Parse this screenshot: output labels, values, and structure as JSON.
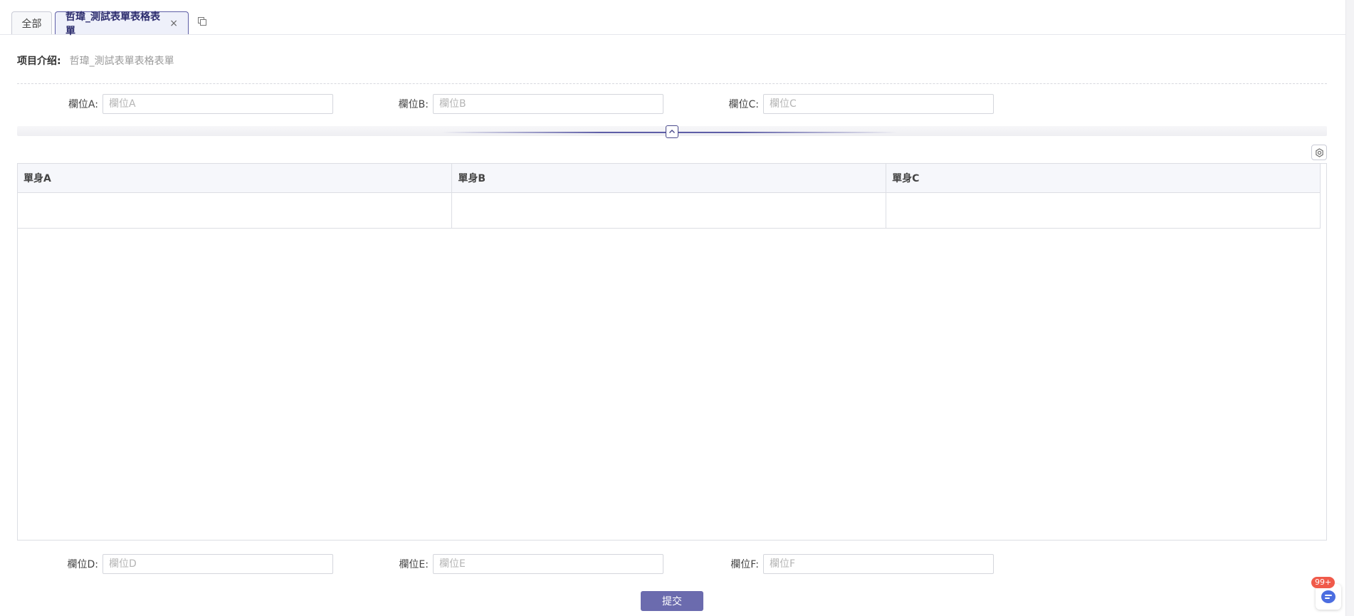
{
  "tabs": {
    "all_label": "全部",
    "active_label": "哲瑋_測試表單表格表單",
    "close_glyph": "×"
  },
  "intro": {
    "label": "项目介绍:",
    "value": "哲瑋_測試表單表格表單"
  },
  "form_top": [
    {
      "label": "欄位A:",
      "placeholder": "欄位A"
    },
    {
      "label": "欄位B:",
      "placeholder": "欄位B"
    },
    {
      "label": "欄位C:",
      "placeholder": "欄位C"
    }
  ],
  "table": {
    "columns": [
      "單身A",
      "單身B",
      "單身C"
    ]
  },
  "form_bottom": [
    {
      "label": "欄位D:",
      "placeholder": "欄位D"
    },
    {
      "label": "欄位E:",
      "placeholder": "欄位E"
    },
    {
      "label": "欄位F:",
      "placeholder": "欄位F"
    }
  ],
  "submit_label": "提交",
  "chat": {
    "badge": "99+",
    "icon": "chat-icon"
  },
  "colors": {
    "accent": "#5e5ea6",
    "button": "#6b6bae",
    "badge": "#f05a4a"
  }
}
